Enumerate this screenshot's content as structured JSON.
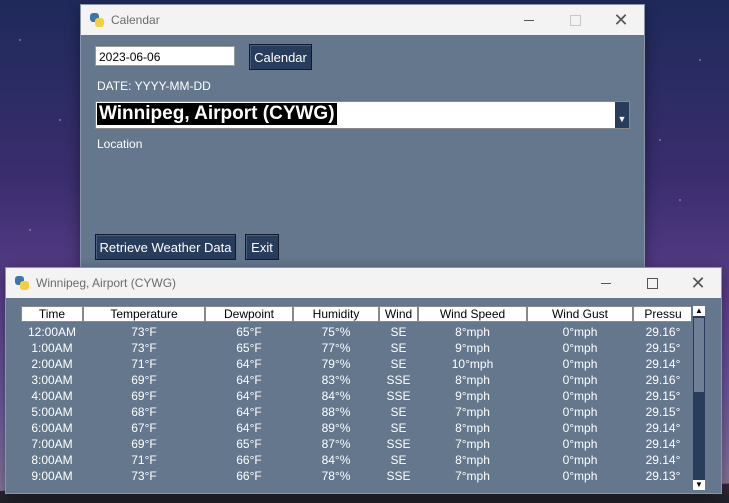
{
  "calendar_window": {
    "title": "Calendar",
    "date_value": "2023-06-06",
    "calendar_button": "Calendar",
    "date_label": "DATE: YYYY-MM-DD",
    "location_value": "Winnipeg, Airport (CYWG)",
    "location_label": "Location",
    "retrieve_button": "Retrieve Weather Data",
    "exit_button": "Exit"
  },
  "table_window": {
    "title": "Winnipeg, Airport (CYWG)",
    "columns": [
      "Time",
      "Temperature",
      "Dewpoint",
      "Humidity",
      "Wind",
      "Wind Speed",
      "Wind Gust",
      "Pressu"
    ],
    "rows": [
      [
        "12:00AM",
        "73°F",
        "65°F",
        "75°%",
        "SE",
        "8°mph",
        "0°mph",
        "29.16°"
      ],
      [
        "1:00AM",
        "73°F",
        "65°F",
        "77°%",
        "SE",
        "9°mph",
        "0°mph",
        "29.15°"
      ],
      [
        "2:00AM",
        "71°F",
        "64°F",
        "79°%",
        "SE",
        "10°mph",
        "0°mph",
        "29.14°"
      ],
      [
        "3:00AM",
        "69°F",
        "64°F",
        "83°%",
        "SSE",
        "8°mph",
        "0°mph",
        "29.16°"
      ],
      [
        "4:00AM",
        "69°F",
        "64°F",
        "84°%",
        "SSE",
        "9°mph",
        "0°mph",
        "29.15°"
      ],
      [
        "5:00AM",
        "68°F",
        "64°F",
        "88°%",
        "SE",
        "7°mph",
        "0°mph",
        "29.15°"
      ],
      [
        "6:00AM",
        "67°F",
        "64°F",
        "89°%",
        "SE",
        "8°mph",
        "0°mph",
        "29.14°"
      ],
      [
        "7:00AM",
        "69°F",
        "65°F",
        "87°%",
        "SSE",
        "7°mph",
        "0°mph",
        "29.14°"
      ],
      [
        "8:00AM",
        "71°F",
        "66°F",
        "84°%",
        "SE",
        "8°mph",
        "0°mph",
        "29.14°"
      ],
      [
        "9:00AM",
        "73°F",
        "66°F",
        "78°%",
        "SSE",
        "7°mph",
        "0°mph",
        "29.13°"
      ]
    ]
  },
  "icons": {
    "app": "python-icon",
    "minimize": "minimize-icon",
    "maximize": "maximize-icon",
    "close": "close-icon"
  },
  "colors": {
    "window_bg": "#64778d",
    "button_bg": "#283c5c",
    "titlebar_bg": "#f3f3f3"
  }
}
